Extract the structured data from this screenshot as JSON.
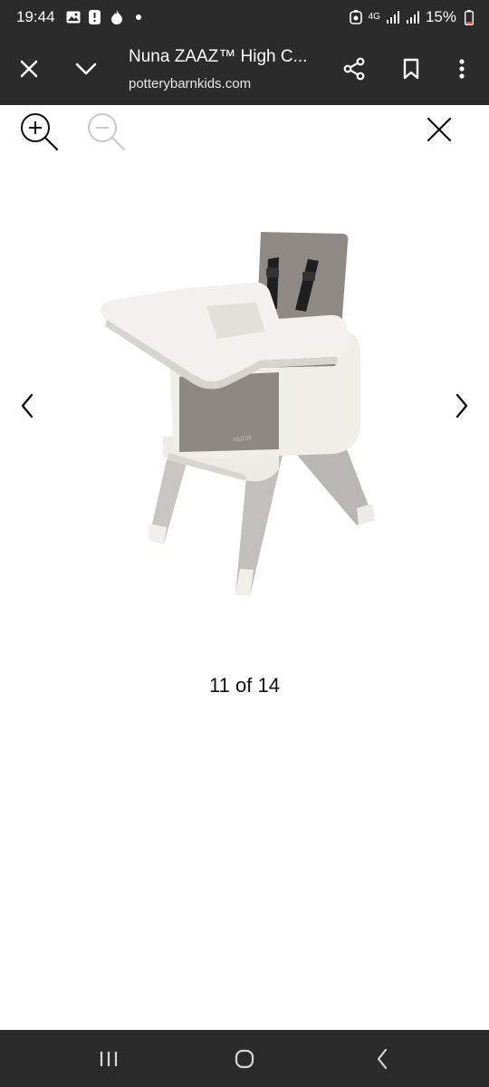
{
  "status_bar": {
    "time": "19:44",
    "battery": "15%",
    "network": "4G",
    "icons": [
      "gallery-icon",
      "alert-icon",
      "flame-icon",
      "dot-icon",
      "battery-saver-icon",
      "signal-icon",
      "roaming-signal-icon",
      "battery-icon"
    ]
  },
  "toolbar": {
    "title": "Nuna ZAAZ™ High C...",
    "url": "potterybarnkids.com"
  },
  "viewer": {
    "counter": "11 of 14",
    "image_alt": "high-chair-image"
  },
  "colors": {
    "bar_bg": "#2b2b2b",
    "content_bg": "#ffffff"
  }
}
